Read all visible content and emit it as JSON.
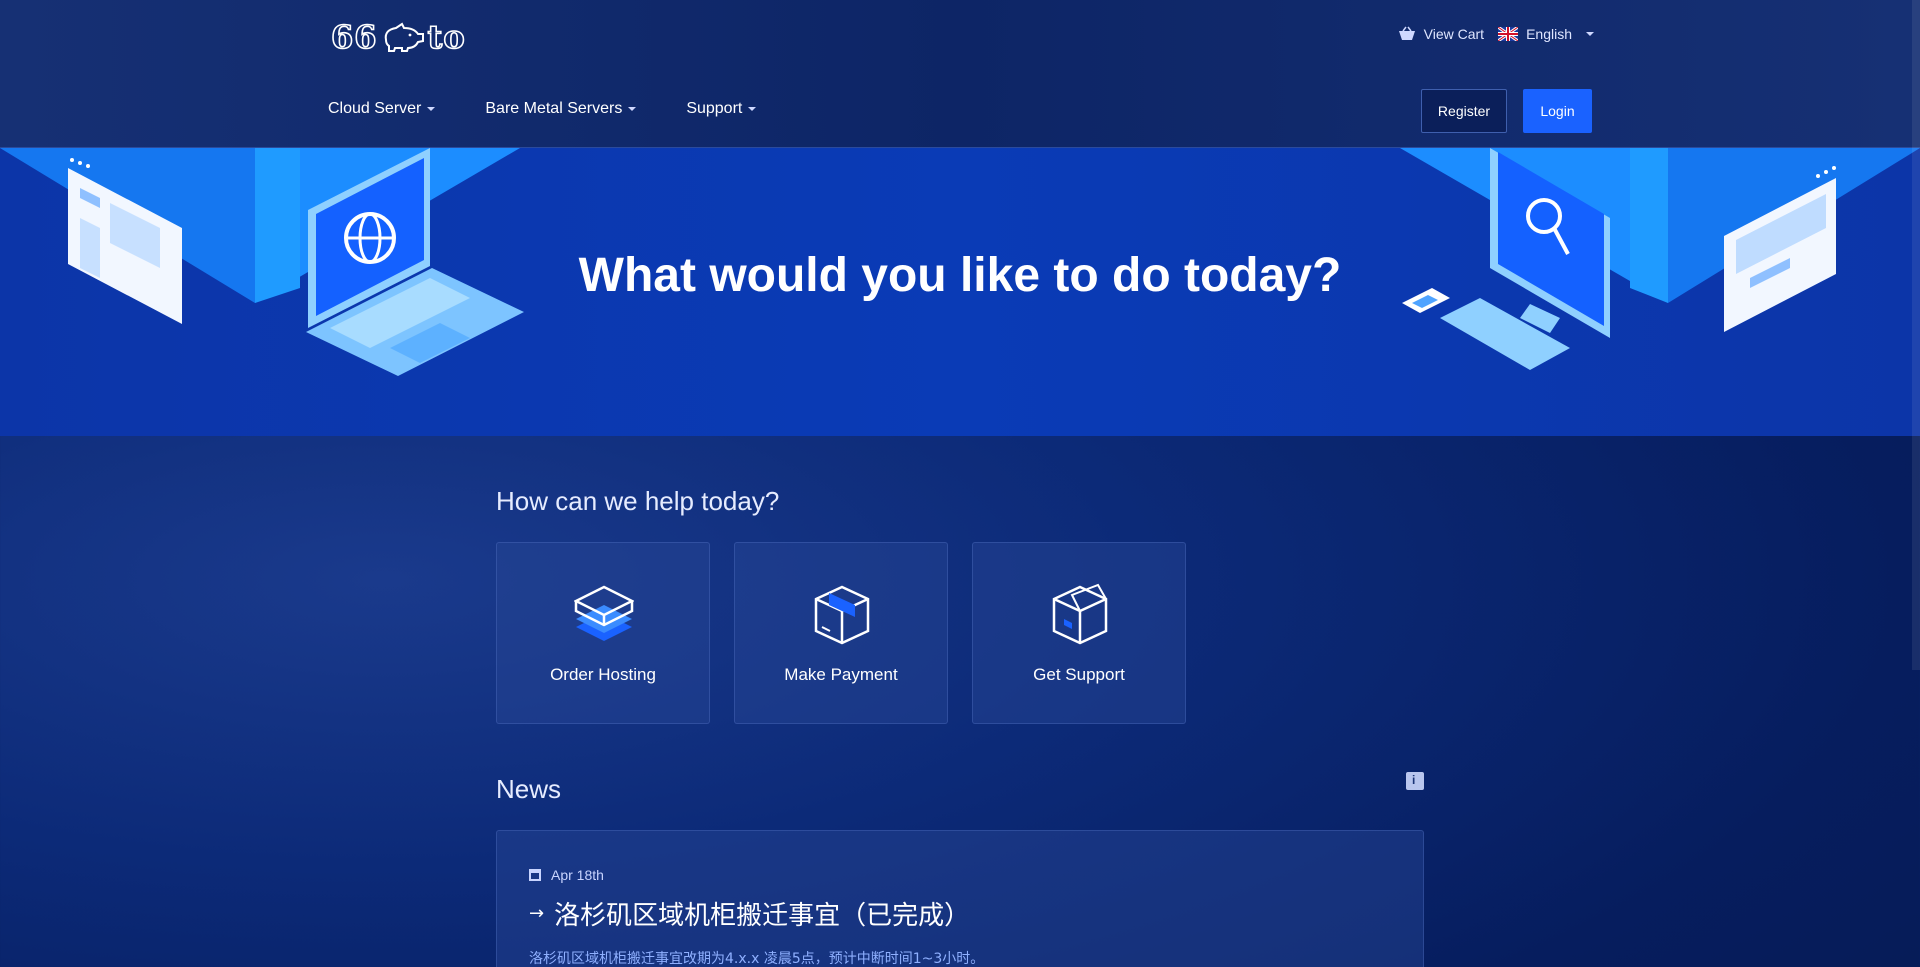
{
  "header": {
    "logo_text_left": "66",
    "logo_text_right": "to",
    "view_cart": "View Cart",
    "language": "English",
    "nav": [
      "Cloud Server",
      "Bare Metal Servers",
      "Support"
    ],
    "register": "Register",
    "login": "Login"
  },
  "hero": {
    "title": "What would you like to do today?"
  },
  "help": {
    "title": "How can we help today?",
    "cards": [
      "Order Hosting",
      "Make Payment",
      "Get Support"
    ]
  },
  "news": {
    "title": "News",
    "items": [
      {
        "date": "Apr 18th",
        "title": "洛杉矶区域机柜搬迁事宜（已完成）",
        "body": "洛杉矶区域机柜搬迁事宜改期为4.x.x 凌晨5点，预计中断时间1~3小时。"
      }
    ]
  },
  "colors": {
    "accent": "#1a62ff",
    "hero_bg": "#0a3bb6",
    "page_bg": "#061d5e"
  }
}
